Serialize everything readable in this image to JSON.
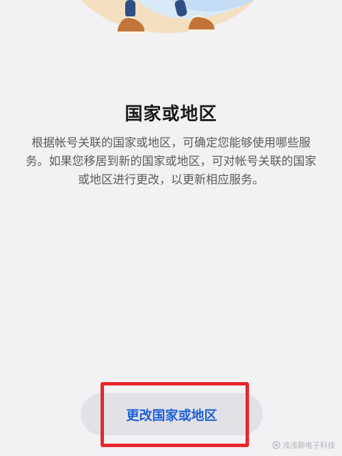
{
  "content": {
    "title": "国家或地区",
    "description": "根据帐号关联的国家或地区，可确定您能够使用哪些服务。如果您移居到新的国家或地区，可对帐号关联的国家或地区进行更改，以更新相应服务。"
  },
  "actions": {
    "change_region_label": "更改国家或地区"
  },
  "watermark": {
    "text": "浅浅聊电子科技"
  },
  "colors": {
    "page_background": "#f2f2f4",
    "button_background": "#e2e2e6",
    "button_text": "#1f5fd8",
    "highlight_border": "#e8262b"
  }
}
